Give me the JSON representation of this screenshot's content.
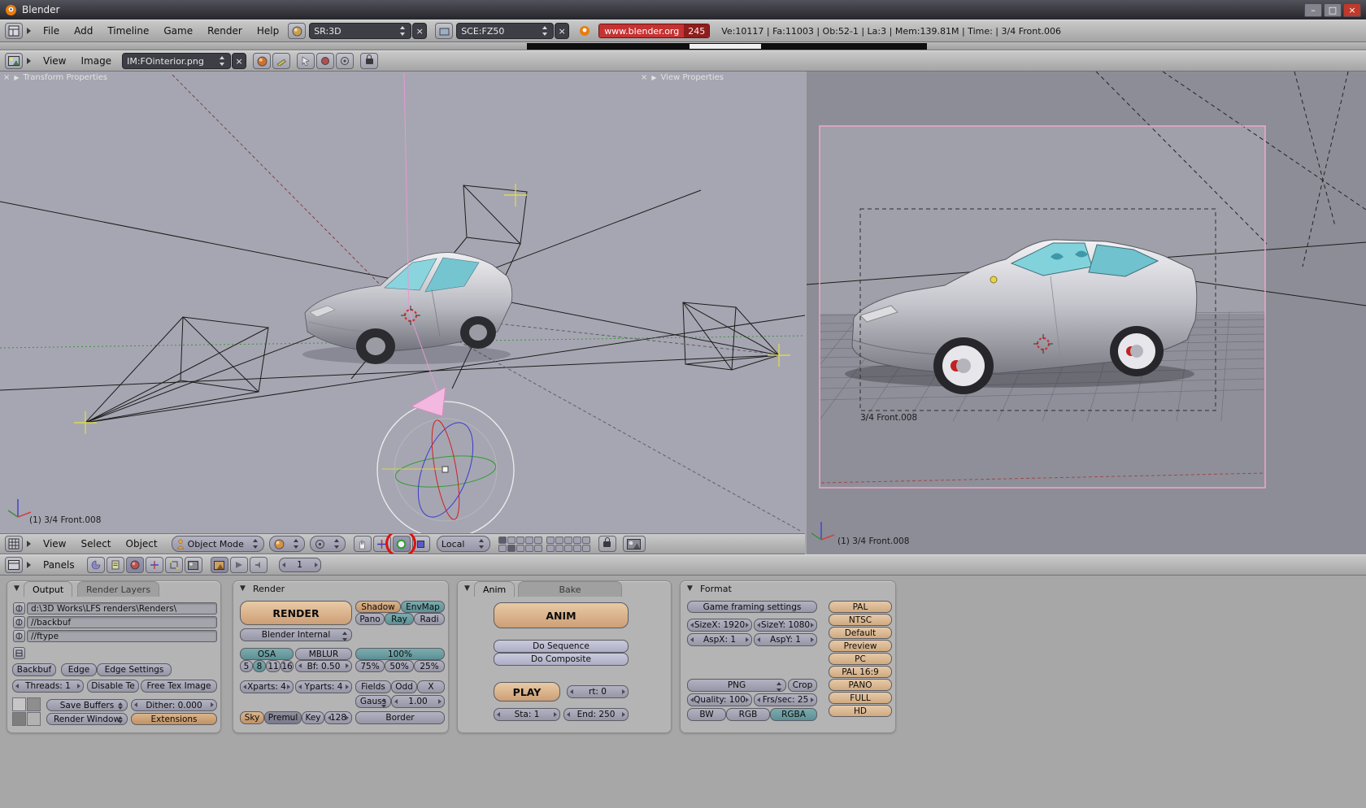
{
  "titlebar": {
    "title": "Blender"
  },
  "icons": {
    "minimize": "–",
    "maximize": "□",
    "close": "×",
    "clear_x": "×",
    "collapse_right": "▶",
    "collapse_down": "▼"
  },
  "info_header": {
    "menus": [
      "File",
      "Add",
      "Timeline",
      "Game",
      "Render",
      "Help"
    ],
    "screen_selector": "SR:3D",
    "scene_selector": "SCE:FZ50",
    "site_label": "www.blender.org",
    "version": "245",
    "stats": "Ve:10117 | Fa:11003 | Ob:52-1 | La:3 | Mem:139.81M | Time: | 3/4 Front.006"
  },
  "image_header": {
    "menus": [
      "View",
      "Image"
    ],
    "image_selector": "IM:FOinterior.png"
  },
  "viewport_left": {
    "transform_properties": "Transform Properties",
    "view_properties": "View Properties",
    "view_label": "(1) 3/4 Front.008"
  },
  "viewport_right": {
    "camera_label": "3/4 Front.008",
    "view_label": "(1) 3/4 Front.008"
  },
  "view3d_header": {
    "menus": [
      "View",
      "Select",
      "Object"
    ],
    "mode": "Object Mode",
    "orientation": "Local"
  },
  "buttons_header": {
    "panels_label": "Panels",
    "frame": "1"
  },
  "output_panel": {
    "tab_output": "Output",
    "tab_render_layers": "Render Layers",
    "path_render": "d:\\3D Works\\LFS renders\\Renders\\",
    "path_backbuf": "//backbuf",
    "path_ftype": "//ftype",
    "backbuf": "Backbuf",
    "edge": "Edge",
    "edge_settings": "Edge Settings",
    "threads": "Threads: 1",
    "disable_te": "Disable Te",
    "free_tex_image": "Free Tex Image",
    "save_buffers": "Save Buffers",
    "dither": "Dither: 0.000",
    "render_window": "Render Window",
    "extensions": "Extensions"
  },
  "render_panel": {
    "title": "Render",
    "render": "RENDER",
    "engine": "Blender Internal",
    "shadow": "Shadow",
    "envmap": "EnvMap",
    "pano": "Pano",
    "ray": "Ray",
    "radi": "Radi",
    "osa": "OSA",
    "mblur": "MBLUR",
    "samples": [
      "5",
      "8",
      "11",
      "16"
    ],
    "bf": "Bf: 0.50",
    "size_100": "100%",
    "size_75": "75%",
    "size_50": "50%",
    "size_25": "25%",
    "xparts": "Xparts: 4",
    "yparts": "Yparts: 4",
    "fields": "Fields",
    "odd": "Odd",
    "x": "X",
    "filter": "Gauss",
    "filter_width": "1.00",
    "sky": "Sky",
    "premul": "Premul",
    "key": "Key",
    "val_128": "128",
    "border": "Border"
  },
  "anim_panel": {
    "tab_anim": "Anim",
    "tab_bake": "Bake",
    "anim": "ANIM",
    "do_sequence": "Do Sequence",
    "do_composite": "Do Composite",
    "play": "PLAY",
    "rt": "rt: 0",
    "sta": "Sta: 1",
    "end": "End: 250"
  },
  "format_panel": {
    "title": "Format",
    "game_framing": "Game framing settings",
    "sizex": "SizeX: 1920",
    "sizey": "SizeY: 1080",
    "aspx": "AspX: 1",
    "aspy": "AspY: 1",
    "filetype": "PNG",
    "crop": "Crop",
    "quality": "Quality: 100",
    "fps": "Frs/sec: 25",
    "bw": "BW",
    "rgb": "RGB",
    "rgba": "RGBA",
    "presets": [
      "PAL",
      "NTSC",
      "Default",
      "Preview",
      "PC",
      "PAL 16:9",
      "PANO",
      "FULL",
      "HD"
    ]
  }
}
